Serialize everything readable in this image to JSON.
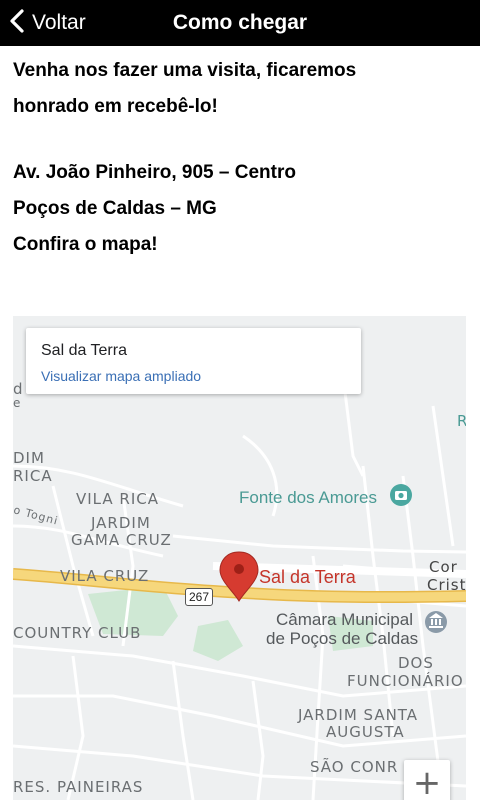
{
  "header": {
    "back_label": "Voltar",
    "title": "Como chegar"
  },
  "content": {
    "line1": "Venha nos fazer uma visita, ficaremos",
    "line2": "honrado em recebê-lo!",
    "address1": "Av. João Pinheiro, 905 – Centro",
    "address2": "Poços de Caldas – MG",
    "cta": "Confira o mapa!"
  },
  "map": {
    "card_title": "Sal da Terra",
    "card_link": "Visualizar mapa ampliado",
    "pin_label": "Sal da Terra",
    "poi_fonte": "Fonte dos Amores",
    "camara_line1": "Câmara Municipal",
    "camara_line2": "de Poços de Caldas",
    "road_shield": "267",
    "neighborhoods": {
      "vila_rica": "VILA RICA",
      "jardim_gama_cruz_1": "JARDIM",
      "jardim_gama_cruz_2": "GAMA CRUZ",
      "vila_cruz": "VILA CRUZ",
      "country_club": "COUNTRY CLUB",
      "dos_funcionarios_1": "DOS",
      "dos_funcionarios_2": "FUNCIONÁRIO",
      "jardim_santa_augusta_1": "JARDIM SANTA",
      "jardim_santa_augusta_2": "AUGUSTA",
      "sao_conrado": "SÃO CONR",
      "res_paineiras": "RES. PAINEIRAS",
      "dim": "DIM",
      "rica": "RICA",
      "centro_1": "Cor",
      "centro_2": "Crista",
      "tognl": "o Togni",
      "left_d": "d",
      "left_e": "e",
      "right_r": "R"
    },
    "zoom_in": "+"
  },
  "colors": {
    "header_bg": "#000000",
    "road_yellow": "#f6d77c",
    "pin_red": "#d63b30",
    "map_bg": "#eef0f1",
    "park_green": "#cfe8d4"
  }
}
